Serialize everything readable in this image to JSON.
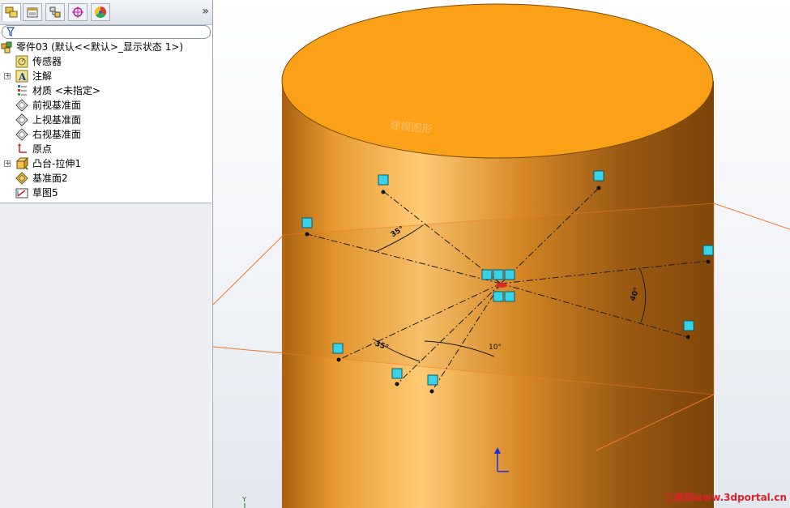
{
  "window": {
    "title": "零件03"
  },
  "toolbar": {
    "tabs": [
      {
        "name": "feature-manager"
      },
      {
        "name": "property-manager"
      },
      {
        "name": "configuration-manager"
      },
      {
        "name": "dimxpert-manager"
      },
      {
        "name": "display-manager"
      }
    ],
    "more_label": "»"
  },
  "feature_tree": {
    "root": {
      "label": "零件03  (默认<<默认>_显示状态 1>)",
      "icon": "part-icon"
    },
    "items": [
      {
        "label": "传感器",
        "icon": "sensor-icon",
        "expander": ""
      },
      {
        "label": "注解",
        "icon": "annotation-icon",
        "expander": "+"
      },
      {
        "label": "材质 <未指定>",
        "icon": "material-icon",
        "expander": ""
      },
      {
        "label": "前视基准面",
        "icon": "plane-icon",
        "expander": ""
      },
      {
        "label": "上视基准面",
        "icon": "plane-icon",
        "expander": ""
      },
      {
        "label": "右视基准面",
        "icon": "plane-icon",
        "expander": ""
      },
      {
        "label": "原点",
        "icon": "origin-icon",
        "expander": ""
      },
      {
        "label": "凸台-拉伸1",
        "icon": "extrude-icon",
        "expander": "+"
      },
      {
        "label": "基准面2",
        "icon": "plane2-icon",
        "expander": ""
      },
      {
        "label": "草图5",
        "icon": "sketch-icon",
        "expander": ""
      }
    ]
  },
  "viewport": {
    "colors": {
      "cylinder": "#e8901a",
      "top_face": "#fba118",
      "plane": "#f07a2a",
      "relation_marker": "#38d3e8"
    },
    "dimensions": [
      "35°",
      "35°",
      "10°",
      "40°"
    ],
    "top_face_text": "建模图形",
    "triad_label": "Y"
  },
  "watermark": "三维网www.3dportal.cn"
}
